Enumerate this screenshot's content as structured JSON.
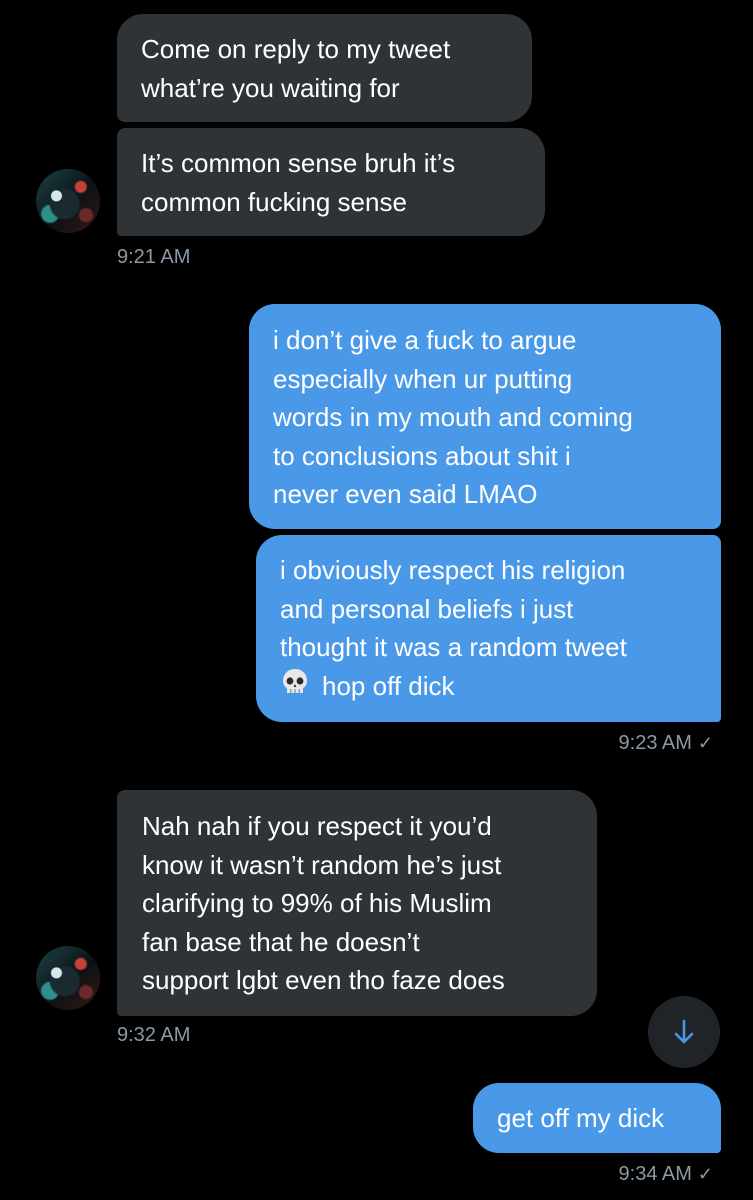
{
  "messages": [
    {
      "lines": [
        "Come on reply to my tweet",
        "what’re you waiting for"
      ]
    },
    {
      "lines": [
        "It’s common sense bruh it’s",
        "common fucking sense"
      ]
    },
    {
      "lines": [
        "i don’t give a fuck to argue",
        "especially when ur putting",
        "words in my mouth and coming",
        "to conclusions about shit i",
        "never even said LMAO"
      ]
    },
    {
      "lines": [
        "i obviously respect his religion",
        "and personal beliefs i just",
        "thought it was a random tweet",
        "hop off dick"
      ]
    },
    {
      "lines": [
        "Nah nah if you respect it you’d",
        "know it wasn’t random he’s just",
        "clarifying to 99% of his Muslim",
        "fan base that he doesn’t",
        "support lgbt even tho faze does"
      ]
    },
    {
      "lines": [
        "get off my dick"
      ]
    }
  ],
  "timestamps": {
    "t1": "9:21 AM",
    "t2": "9:23 AM",
    "t3": "9:32 AM",
    "t4": "9:34 AM"
  },
  "icons": {
    "skull": "skull-emoji",
    "check": "check-icon",
    "scroll_down": "arrow-down-icon"
  },
  "colors": {
    "incoming_bubble": "#2f3336",
    "outgoing_bubble": "#4a99e9",
    "timestamp": "#8b98a5",
    "background": "#000000"
  }
}
